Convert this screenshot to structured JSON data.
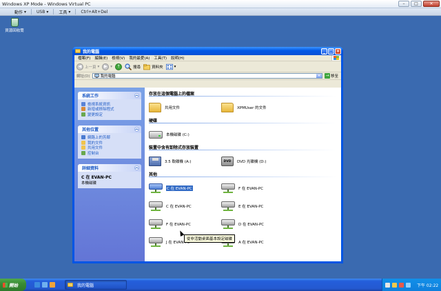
{
  "host": {
    "title": "Windows XP Mode - Windows Virtual PC",
    "menu": [
      {
        "label": "動作",
        "has_arrow": true
      },
      {
        "label": "USB",
        "has_arrow": true
      },
      {
        "label": "工具",
        "has_arrow": true
      },
      {
        "label": "Ctrl+Alt+Del",
        "has_arrow": false
      }
    ]
  },
  "desktop": {
    "recycle_bin_label": "資源回收筒"
  },
  "window": {
    "title": "我的電腦",
    "menu": [
      "檔案(F)",
      "編輯(E)",
      "檢視(V)",
      "我的最愛(A)",
      "工具(T)",
      "說明(H)"
    ],
    "toolbar": {
      "back_label": "上一頁",
      "search_label": "搜尋",
      "folders_label": "資料夾"
    },
    "address": {
      "label": "網址(D)",
      "value": "我的電腦",
      "go_label": "移至"
    }
  },
  "left_panel": {
    "system_tasks": {
      "title": "系統工作",
      "items": [
        "檢視系統資訊",
        "新增或移除程式",
        "變更設定"
      ]
    },
    "other_places": {
      "title": "其他位置",
      "items": [
        "網路上的芳鄰",
        "我的文件",
        "共用文件",
        "控制台"
      ]
    },
    "details": {
      "title": "詳細資料",
      "name": "C 在 EVAN-PC",
      "sub": "本機磁碟"
    }
  },
  "groups": {
    "stored_files": {
      "title": "存放在這個電腦上的檔案",
      "items": [
        "共用文件",
        "XPMUser 的文件"
      ]
    },
    "hard_drives": {
      "title": "硬碟",
      "items": [
        "本機磁碟 (C:)"
      ]
    },
    "removable": {
      "title": "裝置中含有卸除式存放裝置",
      "items": [
        "3.5 軟碟機 (A:)",
        "DVD 光碟機 (D:)"
      ],
      "dvd_icon_text": "DVD"
    },
    "other": {
      "title": "其他",
      "items": [
        "C 在 EVAN-PC",
        "F 在 EVAN-PC",
        "C 在 EVAN-PC",
        "E 在 EVAN-PC",
        "F 在 EVAN-PC",
        "D 在 EVAN-PC",
        "J 在 EVAN-PC",
        "A 在 EVAN-PC"
      ],
      "selected_index": 0
    }
  },
  "tooltip": "從非活動桌面基本設定磁碟",
  "taskbar": {
    "start_label": "開始",
    "task_button": "我的電腦",
    "clock": "下午 02:22"
  },
  "colors": {
    "title_blue": "#0058e6",
    "taskbar_blue": "#245edb",
    "start_green": "#3a8c35",
    "task_link": "#215dc6",
    "selection": "#316ac5"
  }
}
